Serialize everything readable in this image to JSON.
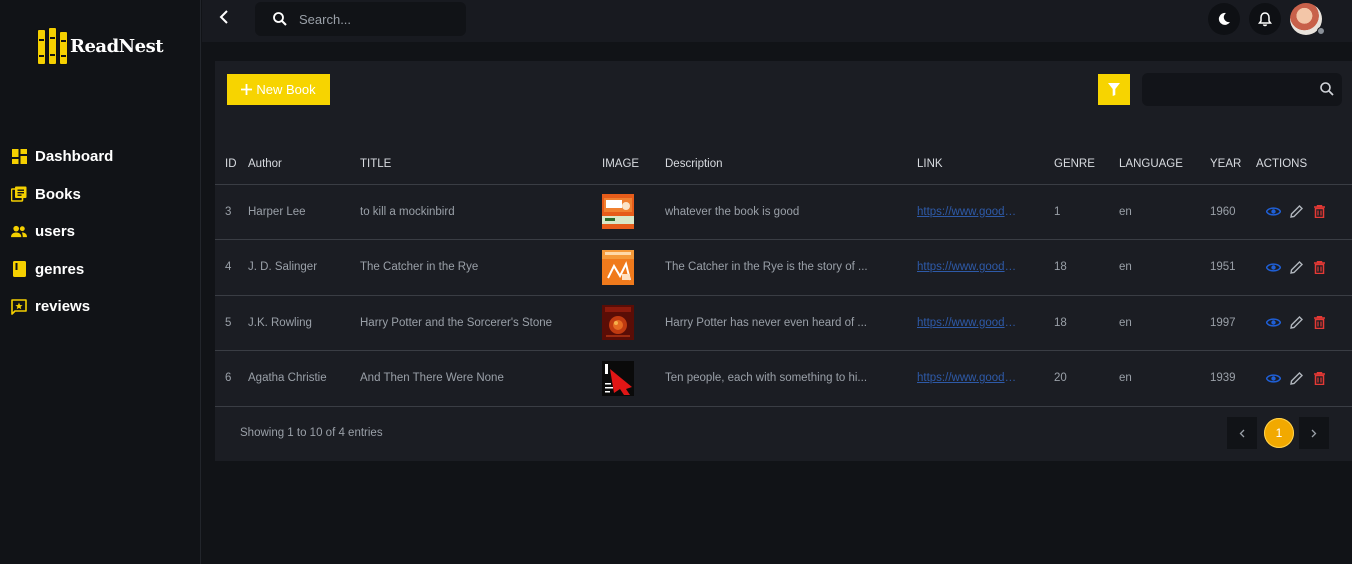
{
  "brand": {
    "name": "ReadNest"
  },
  "sidebar": {
    "items": [
      {
        "label": "Dashboard",
        "icon": "dashboard-icon"
      },
      {
        "label": "Books",
        "icon": "books-icon"
      },
      {
        "label": "users",
        "icon": "users-icon"
      },
      {
        "label": "genres",
        "icon": "genres-icon"
      },
      {
        "label": "reviews",
        "icon": "reviews-icon"
      }
    ]
  },
  "topbar": {
    "search_placeholder": "Search..."
  },
  "toolbar": {
    "new_label": "New Book"
  },
  "table": {
    "headers": [
      "ID",
      "Author",
      "TITLE",
      "IMAGE",
      "Description",
      "LINK",
      "GENRE",
      "LANGUAGE",
      "YEAR",
      "ACTIONS"
    ],
    "rows": [
      {
        "id": "3",
        "author": "Harper Lee",
        "title": "to kill a mockinbird",
        "description": "whatever the book is good",
        "link": "https://www.goodreads.com",
        "genre": "1",
        "language": "en",
        "year": "1960"
      },
      {
        "id": "4",
        "author": "J. D. Salinger",
        "title": "The Catcher in the Rye",
        "description": "The Catcher in the Rye is the story of ...",
        "link": "https://www.goodreads.com",
        "genre": "18",
        "language": "en",
        "year": "1951"
      },
      {
        "id": "5",
        "author": "J.K. Rowling",
        "title": "Harry Potter and the Sorcerer's Stone",
        "description": "Harry Potter has never even heard of ...",
        "link": "https://www.goodreads.com",
        "genre": "18",
        "language": "en",
        "year": "1997"
      },
      {
        "id": "6",
        "author": "Agatha Christie",
        "title": "And Then There Were None",
        "description": "Ten people, each with something to hi...",
        "link": "https://www.goodreads.com",
        "genre": "20",
        "language": "en",
        "year": "1939"
      }
    ]
  },
  "footer": {
    "entries_text": "Showing 1 to 10 of 4 entries",
    "current_page": "1"
  },
  "colors": {
    "accent": "#f7d400",
    "page_active": "#f2a900",
    "view": "#1f5fd6",
    "delete": "#e53935"
  }
}
